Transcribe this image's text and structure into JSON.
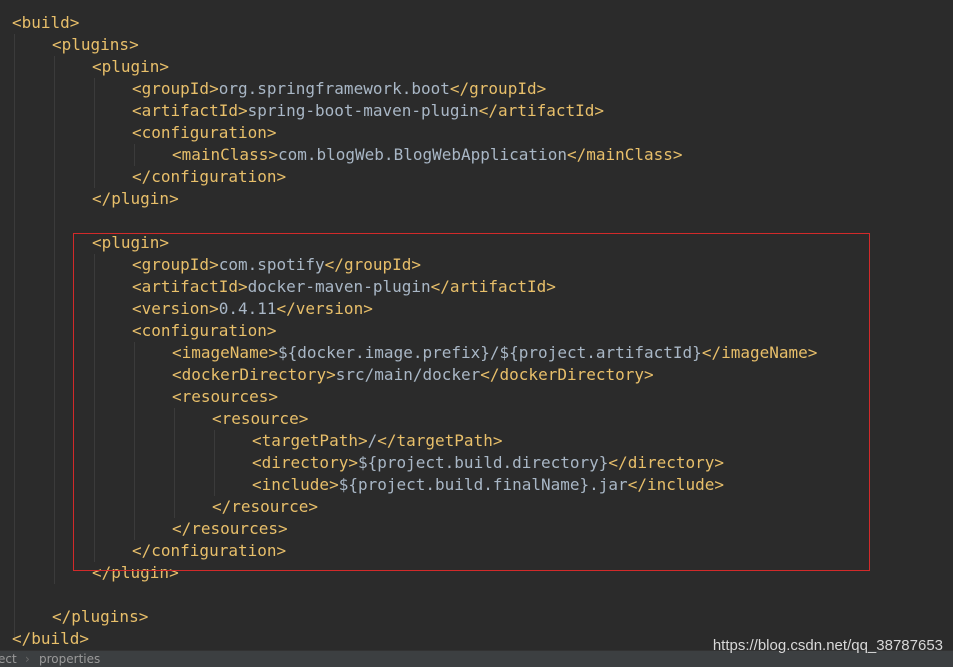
{
  "editor": {
    "lines": [
      {
        "open": "<build>",
        "text": "",
        "close": ""
      },
      {
        "open": "<plugins>",
        "text": "",
        "close": ""
      },
      {
        "open": "<plugin>",
        "text": "",
        "close": ""
      },
      {
        "open": "<groupId>",
        "text": "org.springframework.boot",
        "close": "</groupId>"
      },
      {
        "open": "<artifactId>",
        "text": "spring-boot-maven-plugin",
        "close": "</artifactId>"
      },
      {
        "open": "<configuration>",
        "text": "",
        "close": ""
      },
      {
        "open": "<mainClass>",
        "text": "com.blogWeb.BlogWebApplication",
        "close": "</mainClass>"
      },
      {
        "open": "</configuration>",
        "text": "",
        "close": ""
      },
      {
        "open": "</plugin>",
        "text": "",
        "close": ""
      },
      {
        "open": "",
        "text": "",
        "close": ""
      },
      {
        "open": "<plugin>",
        "text": "",
        "close": ""
      },
      {
        "open": "<groupId>",
        "text": "com.spotify",
        "close": "</groupId>"
      },
      {
        "open": "<artifactId>",
        "text": "docker-maven-plugin",
        "close": "</artifactId>"
      },
      {
        "open": "<version>",
        "text": "0.4.11",
        "close": "</version>"
      },
      {
        "open": "<configuration>",
        "text": "",
        "close": ""
      },
      {
        "open": "<imageName>",
        "text": "${docker.image.prefix}/${project.artifactId}",
        "close": "</imageName>"
      },
      {
        "open": "<dockerDirectory>",
        "text": "src/main/docker",
        "close": "</dockerDirectory>"
      },
      {
        "open": "<resources>",
        "text": "",
        "close": ""
      },
      {
        "open": "<resource>",
        "text": "",
        "close": ""
      },
      {
        "open": "<targetPath>",
        "text": "/",
        "close": "</targetPath>"
      },
      {
        "open": "<directory>",
        "text": "${project.build.directory}",
        "close": "</directory>"
      },
      {
        "open": "<include>",
        "text": "${project.build.finalName}.jar",
        "close": "</include>"
      },
      {
        "open": "</resource>",
        "text": "",
        "close": ""
      },
      {
        "open": "</resources>",
        "text": "",
        "close": ""
      },
      {
        "open": "</configuration>",
        "text": "",
        "close": ""
      },
      {
        "open": "</plugin>",
        "text": "",
        "close": ""
      },
      {
        "open": "",
        "text": "",
        "close": ""
      },
      {
        "open": "</plugins>",
        "text": "",
        "close": ""
      },
      {
        "open": "</build>",
        "text": "",
        "close": ""
      }
    ]
  },
  "statusbar": {
    "crumb_1": "ect",
    "crumb_2": "properties"
  },
  "watermark": "https://blog.csdn.net/qq_38787653",
  "colors": {
    "background": "#2b2b2b",
    "tag": "#e8bf6a",
    "text": "#a9b7c6",
    "highlight_border": "#d22a2a"
  }
}
